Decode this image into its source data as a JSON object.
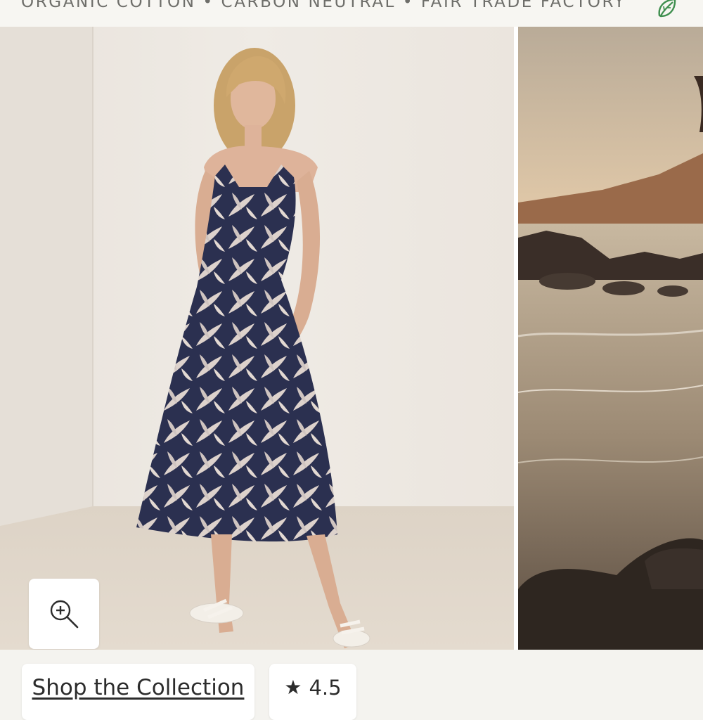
{
  "header": {
    "tagline": "ORGANIC COTTON • CARBON NEUTRAL • FAIR TRADE FACTORY",
    "icon": "leaf-icon"
  },
  "gallery": {
    "images": [
      {
        "name": "model-in-palm-print-midi-dress"
      },
      {
        "name": "beach-at-sunset"
      }
    ],
    "zoom_icon": "zoom-in-icon"
  },
  "actions": {
    "shop_label": "Shop the Collection",
    "rating_icon": "star-icon",
    "rating_value": "4.5"
  },
  "colors": {
    "background": "#f4f3ef",
    "text": "#2c2c2c",
    "tagline": "#6e6e6a",
    "leaf_icon": "#3f8f4f"
  }
}
